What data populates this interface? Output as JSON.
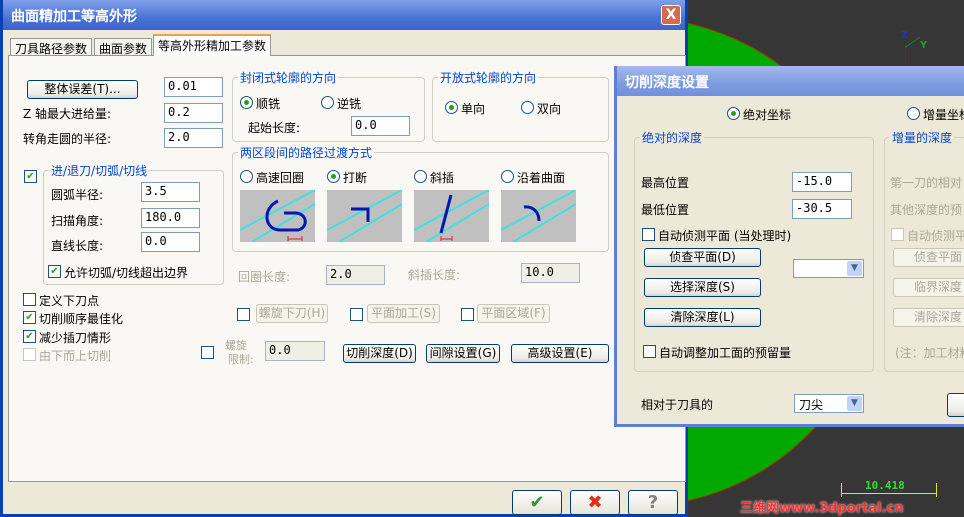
{
  "main_dialog": {
    "title": "曲面精加工等高外形",
    "close_label": "X",
    "tabs": [
      {
        "label": "刀具路径参数"
      },
      {
        "label": "曲面参数"
      },
      {
        "label": "等高外形精加工参数"
      }
    ],
    "tolerance_button": "整体误差(T)...",
    "tolerance_value": "0.01",
    "z_step_label": "Z 轴最大进给量:",
    "z_step_value": "0.2",
    "corner_radius_label": "转角走圆的半径:",
    "corner_radius_value": "2.0",
    "entry_group": {
      "label": "进/退刀/切弧/切线",
      "checked": true,
      "arc_radius_label": "圆弧半径:",
      "arc_radius_value": "3.5",
      "sweep_label": "扫描角度:",
      "sweep_value": "180.0",
      "line_label": "直线长度:",
      "line_value": "0.0",
      "allow_label": "允许切弧/切线超出边界",
      "allow_checked": true
    },
    "options": [
      {
        "label": "定义下刀点",
        "checked": false,
        "enabled": true
      },
      {
        "label": "切削顺序最佳化",
        "checked": true,
        "enabled": true
      },
      {
        "label": "减少插刀情形",
        "checked": true,
        "enabled": true
      },
      {
        "label": "由下而上切削",
        "checked": false,
        "enabled": false
      }
    ],
    "closed_dir": {
      "label": "封闭式轮廓的方向",
      "climb": "顺铣",
      "conventional": "逆铣",
      "selected": "顺铣",
      "start_len_label": "起始长度:",
      "start_len_value": "0.0"
    },
    "open_dir": {
      "label": "开放式轮廓的方向",
      "one_way": "单向",
      "zigzag": "双向",
      "selected": "单向"
    },
    "transition": {
      "label": "两区段间的路径过渡方式",
      "options": [
        "高速回圈",
        "打断",
        "斜插",
        "沿着曲面"
      ],
      "selected": "打断",
      "loop_len_label": "回圈长度:",
      "loop_len_value": "2.0",
      "ramp_len_label": "斜插长度:",
      "ramp_len_value": "10.0"
    },
    "helix_button": "螺旋下刀(H)",
    "steep_button": "平面加工(S)",
    "flat_button": "平面区域(F)",
    "helix_limit_label_1": "螺旋",
    "helix_limit_label_2": "限制:",
    "helix_limit_value": "0.0",
    "depth_cuts_button": "切削深度(D)",
    "gap_button": "间隙设置(G)",
    "advanced_button": "高级设置(E)",
    "ok_icon": "✔",
    "cancel_icon": "✖",
    "help_icon": "?"
  },
  "depth_dialog": {
    "title": "切削深度设置",
    "absolute_label": "绝对坐标",
    "incremental_label": "增量坐标",
    "selected": "绝对坐标",
    "abs_group": {
      "label": "绝对的深度",
      "top_label": "最高位置",
      "top_value": "-15.0",
      "bottom_label": "最低位置",
      "bottom_value": "-30.5",
      "auto_detect_label": "自动侦测平面 (当处理时)",
      "detect_button": "侦查平面(D)",
      "select_button": "选择深度(S)",
      "clear_button": "清除深度(L)",
      "dropdown_value": "",
      "auto_adjust_label": "自动调整加工面的预留量"
    },
    "inc_group": {
      "label": "增量的深度",
      "first_label": "第一刀的相对",
      "other_label": "其他深度的预",
      "auto_detect_label": "自动侦测平",
      "detect_button": "侦查平面",
      "critical_button": "临界深度",
      "clear_button": "清除深度",
      "note": "(注：加工材料"
    },
    "relative_label": "相对于刀具的",
    "relative_value": "刀尖"
  },
  "viewport": {
    "axis_z": "Z",
    "axis_y": "Y",
    "scale_value": "10.418",
    "watermark": "三维网www.3dportal.cn"
  }
}
